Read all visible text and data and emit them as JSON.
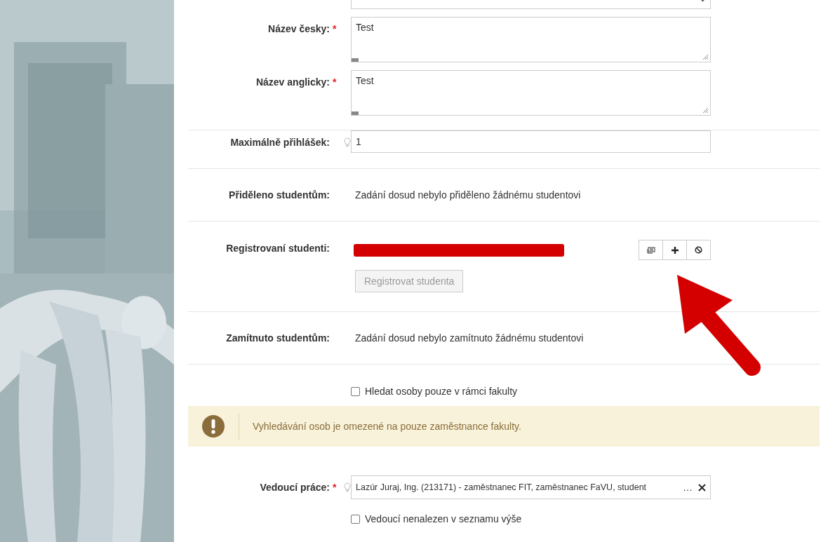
{
  "sections": [
    [
      {
        "kind": "select"
      },
      {
        "kind": "textarea",
        "label": "Název česky:",
        "required_mark": "*",
        "value": "Test"
      },
      {
        "kind": "textarea",
        "label": "Název anglicky:",
        "required_mark": "*",
        "value": "Test"
      }
    ],
    [
      {
        "kind": "input",
        "label": "Maximálně přihlášek:",
        "hint": true,
        "value": "1"
      }
    ],
    [
      {
        "kind": "text",
        "label": "Přiděleno studentům:",
        "value": "Zadání dosud nebylo přiděleno žádnému studentovi"
      }
    ],
    [
      {
        "kind": "registered",
        "label": "Registrovaní studenti:",
        "redacted": true,
        "button": {
          "label": "Registrovat studenta",
          "disabled": true
        }
      }
    ],
    [
      {
        "kind": "text",
        "label": "Zamítnuto studentům:",
        "value": "Zadání dosud nebylo zamítnuto žádnému studentovi"
      }
    ]
  ],
  "footer": [
    {
      "kind": "checkbox",
      "label": "Hledat osoby pouze v rámci fakulty",
      "checked": false
    },
    {
      "kind": "alert",
      "text": "Vyhledávání osob je omezené na pouze zaměstnance fakulty."
    },
    {
      "kind": "autocomplete",
      "label": "Vedoucí práce:",
      "required_mark": "*",
      "hint": true,
      "value": "Lazúr Juraj, Ing. (213171) - zaměstnanec FIT, zaměstnanec FaVU, student",
      "ellipsis": "…"
    },
    {
      "kind": "checkbox",
      "label": "Vedoucí nenalezen v seznamu výše",
      "checked": false
    }
  ],
  "annotations": [
    {
      "kind": "arrow"
    }
  ]
}
